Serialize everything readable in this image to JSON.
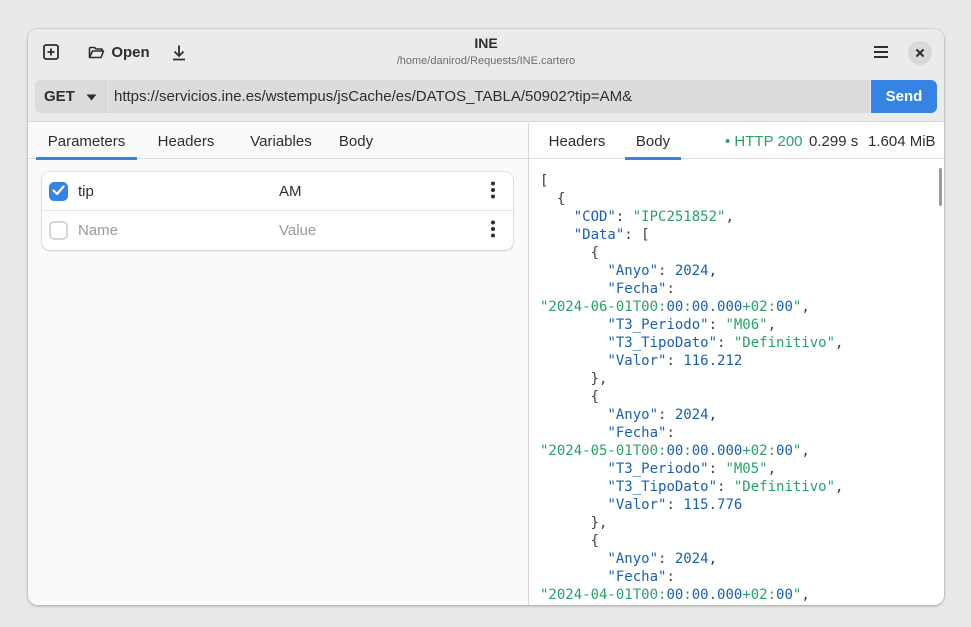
{
  "window": {
    "title": "INE",
    "subtitle": "/home/danirod/Requests/INE.cartero"
  },
  "toolbar": {
    "new_icon": "new-tab-icon",
    "open_label": "Open",
    "open_icon": "folder-open-icon",
    "save_icon": "download-icon",
    "menu_icon": "hamburger-menu-icon",
    "close_icon": "close-icon"
  },
  "request": {
    "method": "GET",
    "url": "https://servicios.ine.es/wstempus/jsCache/es/DATOS_TABLA/50902?tip=AM&",
    "send_label": "Send"
  },
  "left_tabs": [
    "Parameters",
    "Headers",
    "Variables",
    "Body"
  ],
  "params": [
    {
      "name": "tip",
      "value": "AM",
      "checked": true
    }
  ],
  "new_param": {
    "name_placeholder": "Name",
    "value_placeholder": "Value"
  },
  "right_tabs": [
    "Headers",
    "Body"
  ],
  "response": {
    "status": "• HTTP 200",
    "time": "0.299 s",
    "size": "1.604 MiB"
  },
  "response_body_lines": [
    "[",
    "  {",
    "    \"COD\": \"IPC251852\",",
    "    \"Data\": [",
    "      {",
    "        \"Anyo\": 2024,",
    "        \"Fecha\":",
    "\"2024-06-01T00:00:00.000+02:00\",",
    "        \"T3_Periodo\": \"M06\",",
    "        \"T3_TipoDato\": \"Definitivo\",",
    "        \"Valor\": 116.212",
    "      },",
    "      {",
    "        \"Anyo\": 2024,",
    "        \"Fecha\":",
    "\"2024-05-01T00:00:00.000+02:00\",",
    "        \"T3_Periodo\": \"M05\",",
    "        \"T3_TipoDato\": \"Definitivo\",",
    "        \"Valor\": 115.776",
    "      },",
    "      {",
    "        \"Anyo\": 2024,",
    "        \"Fecha\":",
    "\"2024-04-01T00:00:00.000+02:00\","
  ],
  "colors": {
    "accent": "#3584e4",
    "success": "#26a269",
    "json_key": "#1a5fb4"
  }
}
